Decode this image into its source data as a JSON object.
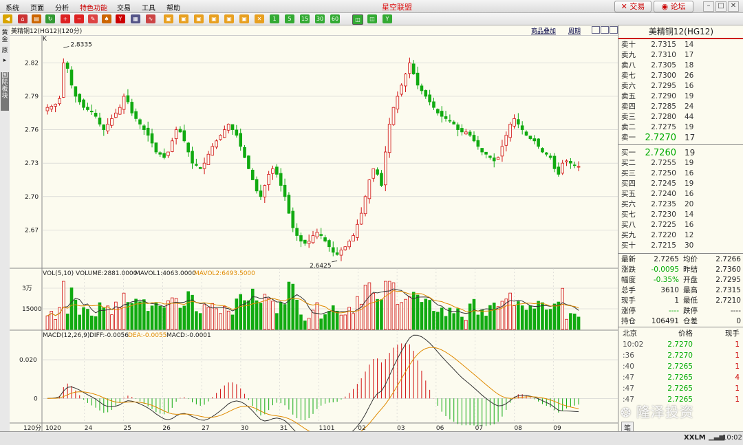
{
  "app": {
    "title": "星空联盟"
  },
  "menu": [
    "系统",
    "页面",
    "分析",
    "特色功能",
    "交易",
    "工具",
    "帮助"
  ],
  "top_buttons": {
    "trade": "交易",
    "forum": "论坛"
  },
  "left_tabs": {
    "tab1": "黄金",
    "tab2": "原",
    "tab3": "国际板块"
  },
  "toolbar": {
    "period_buttons": [
      "1",
      "5",
      "15",
      "30",
      "60"
    ]
  },
  "chart_header": {
    "symbol": "美精铜12(HG12)",
    "period": "(120分)",
    "overlay_link": "商品叠加",
    "period_link": "周期",
    "k_label": "K"
  },
  "colors": {
    "up": "#d11111",
    "down": "#11aa11",
    "ma1": "#333333",
    "ma2": "#e08a00",
    "grid": "#cccccc"
  },
  "chart_data": [
    {
      "type": "line",
      "title": "美精铜12(HG12) (120分)",
      "ylim": [
        2.64,
        2.84
      ],
      "yticks": [
        2.82,
        2.79,
        2.76,
        2.73,
        2.7,
        2.67
      ],
      "x_labels": [
        "1020",
        "24",
        "25",
        "26",
        "27",
        "30",
        "31",
        "1101",
        "02",
        "03",
        "06",
        "07",
        "08",
        "09"
      ],
      "annotations": [
        {
          "text": "2.8335",
          "value": 2.8335
        },
        {
          "text": "2.6425",
          "value": 2.6425
        }
      ],
      "close_series": [
        2.78,
        2.781,
        2.783,
        2.788,
        2.82,
        2.815,
        2.8,
        2.79,
        2.785,
        2.78,
        2.778,
        2.776,
        2.772,
        2.765,
        2.76,
        2.765,
        2.77,
        2.775,
        2.78,
        2.79,
        2.785,
        2.775,
        2.77,
        2.765,
        2.76,
        2.755,
        2.748,
        2.74,
        2.738,
        2.735,
        2.74,
        2.75,
        2.76,
        2.758,
        2.75,
        2.74,
        2.73,
        2.728,
        2.725,
        2.73,
        2.738,
        2.745,
        2.75,
        2.755,
        2.76,
        2.765,
        2.76,
        2.755,
        2.745,
        2.735,
        2.725,
        2.715,
        2.705,
        2.7,
        2.71,
        2.72,
        2.725,
        2.72,
        2.71,
        2.7,
        2.685,
        2.672,
        2.665,
        2.66,
        2.658,
        2.66,
        2.665,
        2.668,
        2.665,
        2.66,
        2.655,
        2.65,
        2.648,
        2.652,
        2.655,
        2.66,
        2.665,
        2.675,
        2.685,
        2.7,
        2.715,
        2.725,
        2.72,
        2.71,
        2.74,
        2.765,
        2.78,
        2.79,
        2.8,
        2.81,
        2.82,
        2.81,
        2.8,
        2.795,
        2.79,
        2.785,
        2.78,
        2.775,
        2.772,
        2.77,
        2.768,
        2.765,
        2.76,
        2.758,
        2.758,
        2.755,
        2.75,
        2.745,
        2.74,
        2.738,
        2.735,
        2.732,
        2.735,
        2.745,
        2.755,
        2.765,
        2.77,
        2.765,
        2.76,
        2.755,
        2.752,
        2.75,
        2.745,
        2.74,
        2.738,
        2.735,
        2.725,
        2.72,
        2.73,
        2.732,
        2.73,
        2.728,
        2.727
      ],
      "volume_ylim": [
        0,
        37000
      ],
      "volume_yticks": [
        "3万",
        "15000"
      ],
      "volume_legend": {
        "label": "VOL(5,10)",
        "volume": "VOLUME:2881.0000",
        "mavol1": "MAVOL1:4063.0000",
        "mavol2": "MAVOL2:6493.5000"
      },
      "macd_ylim": [
        -0.012,
        0.03
      ],
      "macd_yticks": [
        "0.020",
        "0"
      ],
      "macd_legend": {
        "label": "MACD(12,26,9)",
        "diff": "DIFF:-0.0056",
        "dea": "DEA:-0.0055",
        "macd": "MACD:-0.0001"
      }
    }
  ],
  "orderbook": {
    "title": "美精铜12(HG12)",
    "asks": [
      {
        "label": "卖十",
        "price": "2.7315",
        "vol": "14"
      },
      {
        "label": "卖九",
        "price": "2.7310",
        "vol": "17"
      },
      {
        "label": "卖八",
        "price": "2.7305",
        "vol": "18"
      },
      {
        "label": "卖七",
        "price": "2.7300",
        "vol": "26"
      },
      {
        "label": "卖六",
        "price": "2.7295",
        "vol": "16"
      },
      {
        "label": "卖五",
        "price": "2.7290",
        "vol": "19"
      },
      {
        "label": "卖四",
        "price": "2.7285",
        "vol": "24"
      },
      {
        "label": "卖三",
        "price": "2.7280",
        "vol": "44"
      },
      {
        "label": "卖二",
        "price": "2.7275",
        "vol": "19"
      },
      {
        "label": "卖一",
        "price": "2.7270",
        "vol": "17"
      }
    ],
    "bids": [
      {
        "label": "买一",
        "price": "2.7260",
        "vol": "19"
      },
      {
        "label": "买二",
        "price": "2.7255",
        "vol": "19"
      },
      {
        "label": "买三",
        "price": "2.7250",
        "vol": "16"
      },
      {
        "label": "买四",
        "price": "2.7245",
        "vol": "19"
      },
      {
        "label": "买五",
        "price": "2.7240",
        "vol": "16"
      },
      {
        "label": "买六",
        "price": "2.7235",
        "vol": "20"
      },
      {
        "label": "买七",
        "price": "2.7230",
        "vol": "14"
      },
      {
        "label": "买八",
        "price": "2.7225",
        "vol": "16"
      },
      {
        "label": "买九",
        "price": "2.7220",
        "vol": "12"
      },
      {
        "label": "买十",
        "price": "2.7215",
        "vol": "30"
      }
    ]
  },
  "stats": [
    {
      "l1": "最新",
      "v1": "2.7265",
      "l2": "均价",
      "v2": "2.7266"
    },
    {
      "l1": "涨跌",
      "v1": "-0.0095",
      "l2": "昨结",
      "v2": "2.7360"
    },
    {
      "l1": "幅度",
      "v1": "-0.35%",
      "l2": "开盘",
      "v2": "2.7295"
    },
    {
      "l1": "总手",
      "v1": "3610",
      "l2": "最高",
      "v2": "2.7315"
    },
    {
      "l1": "现手",
      "v1": "1",
      "l2": "最低",
      "v2": "2.7210"
    },
    {
      "l1": "涨停",
      "v1": "----",
      "l2": "跌停",
      "v2": "----"
    },
    {
      "l1": "持仓",
      "v1": "106491",
      "l2": "仓差",
      "v2": "0"
    }
  ],
  "ticks": {
    "header": {
      "time": "北京",
      "price": "价格",
      "vol": "现手"
    },
    "rows": [
      {
        "time": "10:02",
        "price": "2.7270",
        "vol": "1"
      },
      {
        "time": ":36",
        "price": "2.7270",
        "vol": "1"
      },
      {
        "time": ":40",
        "price": "2.7265",
        "vol": "1"
      },
      {
        "time": ":47",
        "price": "2.7265",
        "vol": "4"
      },
      {
        "time": ":47",
        "price": "2.7265",
        "vol": "1"
      },
      {
        "time": ":47",
        "price": "2.7265",
        "vol": "1"
      }
    ]
  },
  "bottom": {
    "period_tag": "120分",
    "tick_tab": "笔"
  },
  "watermark": {
    "text": "隆泽投资"
  },
  "status": {
    "brand": "XXLM",
    "time": "10:02"
  }
}
